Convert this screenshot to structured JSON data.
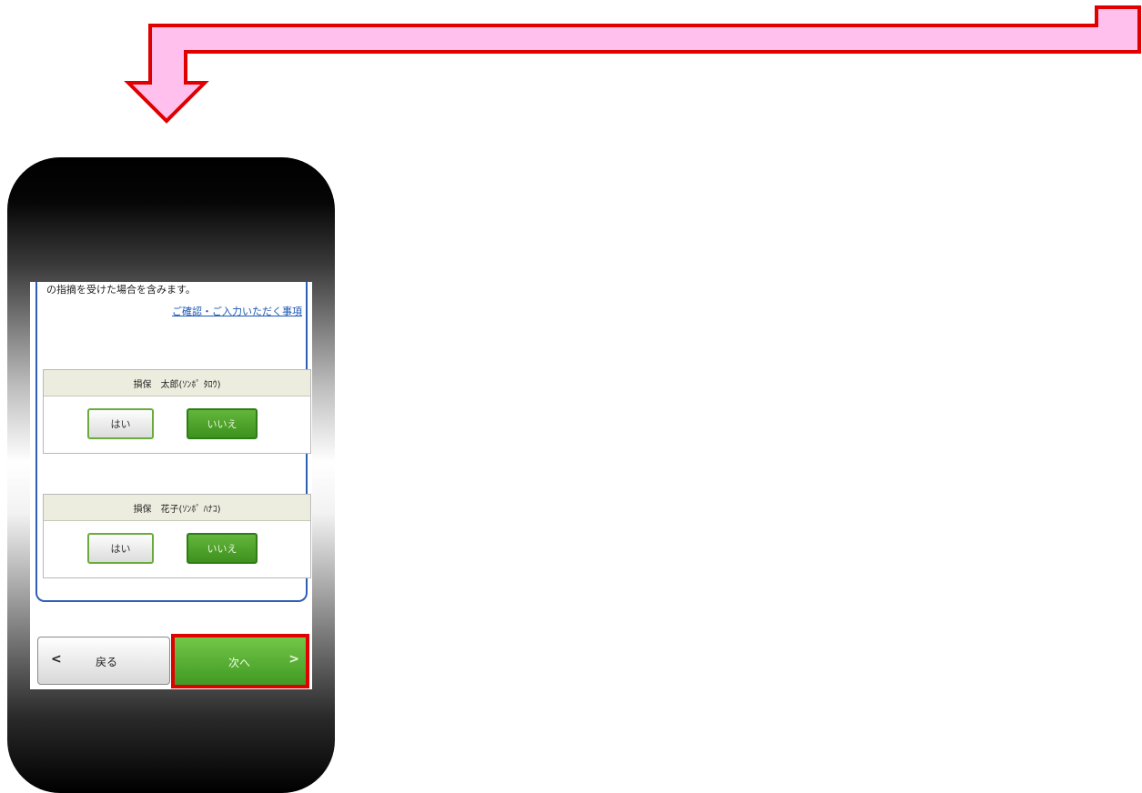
{
  "notice_text": "の指摘を受けた場合を含みます。",
  "confirm_link": "ご確認・ご入力いただく事項",
  "persons": [
    {
      "name": "損保　太郎(ｿﾝﾎﾟ ﾀﾛｳ)",
      "yes_label": "はい",
      "no_label": "いいえ",
      "selected": "no"
    },
    {
      "name": "損保　花子(ｿﾝﾎﾟ ﾊﾅｺ)",
      "yes_label": "はい",
      "no_label": "いいえ",
      "selected": "no"
    }
  ],
  "footer": {
    "back_label": "戻る",
    "next_label": "次へ",
    "back_icon": "chevron-left-icon",
    "next_icon": "chevron-right-icon"
  },
  "colors": {
    "arrow_fill": "#ffc0ee",
    "arrow_stroke": "#e00000",
    "highlight": "#e00000",
    "primary_green": "#4aa62a",
    "link_blue": "#1b56b3",
    "card_border": "#2d5fb5"
  }
}
